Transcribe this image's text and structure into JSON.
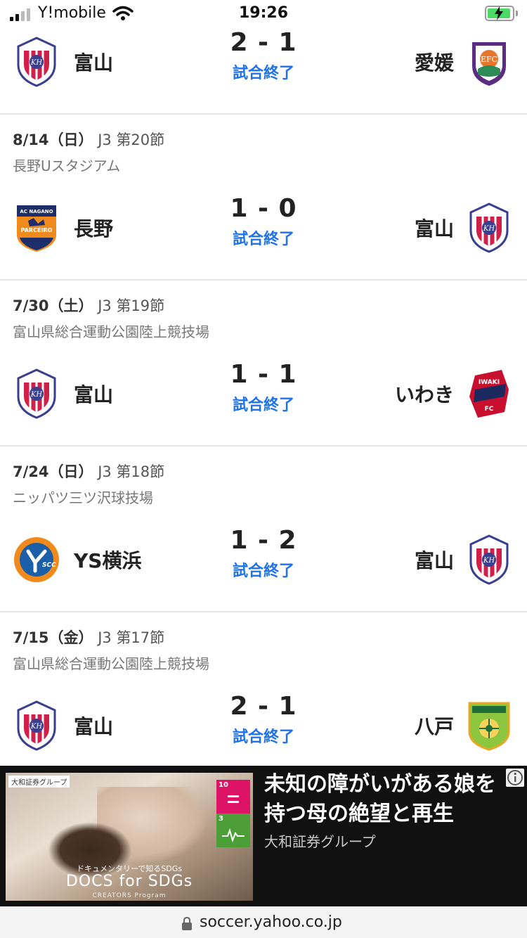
{
  "status_bar": {
    "carrier": "Y!mobile",
    "time": "19:26"
  },
  "colors": {
    "result_blue": "#1e73e8",
    "divider": "#e6e6e6",
    "ad_background": "#111111"
  },
  "matches": [
    {
      "home": "富山",
      "away": "愛媛",
      "score": "2 - 1",
      "result": "試合終了",
      "home_emblem": "toyama-emblem",
      "away_emblem": "ehime-emblem"
    },
    {
      "date": "8/14（日）",
      "league": "J3 第20節",
      "venue": "長野Uスタジアム",
      "home": "長野",
      "away": "富山",
      "score": "1 - 0",
      "result": "試合終了",
      "home_emblem": "nagano-emblem",
      "away_emblem": "toyama-emblem"
    },
    {
      "date": "7/30（土）",
      "league": "J3 第19節",
      "venue": "富山県総合運動公園陸上競技場",
      "home": "富山",
      "away": "いわき",
      "score": "1 - 1",
      "result": "試合終了",
      "home_emblem": "toyama-emblem",
      "away_emblem": "iwaki-emblem"
    },
    {
      "date": "7/24（日）",
      "league": "J3 第18節",
      "venue": "ニッパツ三ツ沢球技場",
      "home": "YS横浜",
      "away": "富山",
      "score": "1 - 2",
      "result": "試合終了",
      "home_emblem": "ys-yokohama-emblem",
      "away_emblem": "toyama-emblem"
    },
    {
      "date": "7/15（金）",
      "league": "J3 第17節",
      "venue": "富山県総合運動公園陸上競技場",
      "home": "富山",
      "away": "八戸",
      "score": "2 - 1",
      "result": "試合終了",
      "home_emblem": "toyama-emblem",
      "away_emblem": "hachinohe-emblem"
    }
  ],
  "ad": {
    "image_tag": "大和証券グループ",
    "image_subtitle": "ドキュメンタリーで知るSDGs",
    "image_brand": "DOCS for SDGs",
    "image_program": "CREATORS Program",
    "title": "未知の障がいがある娘を持つ母の絶望と再生",
    "sponsor": "大和証券グループ",
    "sdg_goals": [
      "10",
      "3"
    ]
  },
  "url_bar": {
    "url": "soccer.yahoo.co.jp"
  }
}
